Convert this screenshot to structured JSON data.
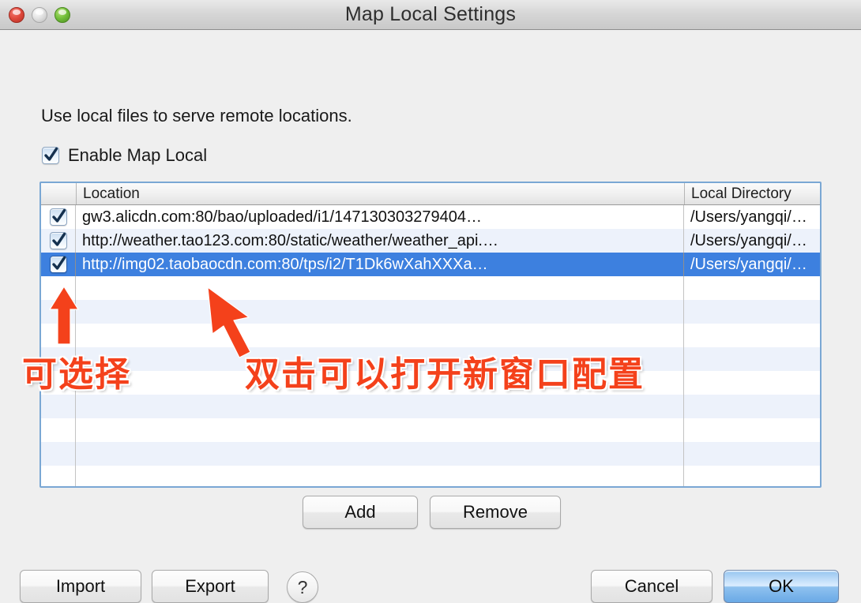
{
  "window": {
    "title": "Map Local Settings",
    "traffic_lights": [
      "close-button",
      "minimize-button",
      "zoom-button"
    ]
  },
  "intro": {
    "text": "Use local files to serve remote locations."
  },
  "enable_map_local": {
    "label": "Enable Map Local",
    "checked": true
  },
  "table": {
    "columns": [
      "",
      "Location",
      "Local Directory"
    ],
    "rows": [
      {
        "checked": true,
        "location": "gw3.alicdn.com:80/bao/uploaded/i1/147130303279404…",
        "local_directory": "/Users/yangqi/…",
        "selected": false
      },
      {
        "checked": true,
        "location": "http://weather.tao123.com:80/static/weather/weather_api.…",
        "local_directory": "/Users/yangqi/…",
        "selected": false
      },
      {
        "checked": true,
        "location": "http://img02.taobaocdn.com:80/tps/i2/T1Dk6wXahXXXa…",
        "local_directory": "/Users/yangqi/…",
        "selected": true
      }
    ],
    "empty_row_count": 9
  },
  "annotations": [
    {
      "text": "可选择",
      "color": "#f4411b"
    },
    {
      "text": "双击可以打开新窗口配置",
      "color": "#f4411b"
    }
  ],
  "buttons": {
    "add": "Add",
    "remove": "Remove",
    "import": "Import",
    "export": "Export",
    "help": "?",
    "cancel": "Cancel",
    "ok": "OK"
  },
  "colors": {
    "selection_blue": "#3d80df",
    "table_border": "#7aa7d4",
    "stripe_blue": "#edf2fb",
    "annotation_red": "#f4411b",
    "default_button_blue": "#8fc2ef"
  }
}
